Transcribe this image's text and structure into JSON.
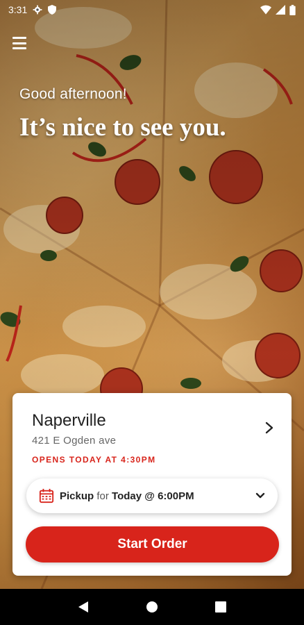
{
  "status_bar": {
    "time": "3:31",
    "icons": [
      "settings-icon",
      "shield-icon",
      "wifi-icon",
      "signal-icon",
      "battery-icon"
    ]
  },
  "header": {
    "menu_icon": "hamburger-menu-icon"
  },
  "hero": {
    "greeting": "Good afternoon!",
    "headline": "It’s nice to see you."
  },
  "store_card": {
    "name": "Naperville",
    "address": "421 E Ogden ave",
    "hours": "OPENS TODAY AT 4:30PM",
    "chevron_icon": "chevron-right-icon"
  },
  "pickup": {
    "method": "Pickup",
    "for_word": "for",
    "time": "Today @ 6:00PM",
    "calendar_icon": "calendar-icon",
    "dropdown_icon": "chevron-down-icon"
  },
  "actions": {
    "start_order_label": "Start Order"
  },
  "nav_bar": {
    "icons": [
      "back-icon",
      "home-icon",
      "recents-icon"
    ]
  },
  "colors": {
    "accent": "#d8241b",
    "card_bg": "#ffffff",
    "text_primary": "#222222",
    "text_secondary": "#666666"
  }
}
